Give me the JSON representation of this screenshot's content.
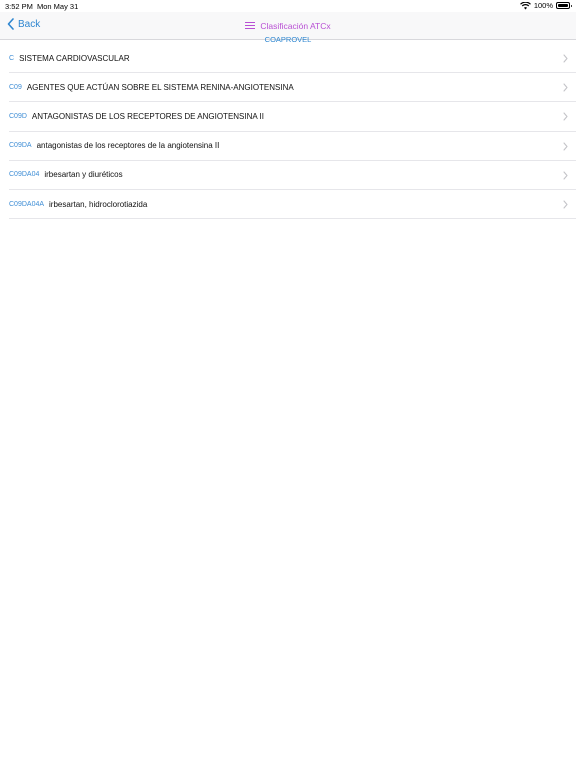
{
  "status": {
    "time": "3:52 PM",
    "date": "Mon May 31",
    "battery": "100%",
    "battery_level": 1.0
  },
  "nav": {
    "back_label": "Back",
    "title": "Clasificación ATCx",
    "subtitle": "COAPROVEL"
  },
  "colors": {
    "accent_blue": "#2e86d0",
    "title_purple": "#b84fd4",
    "code_blue": "#3e8dd5"
  },
  "items": [
    {
      "code": "C",
      "label": "SISTEMA CARDIOVASCULAR"
    },
    {
      "code": "C09",
      "label": "AGENTES QUE ACTÚAN SOBRE EL SISTEMA RENINA-ANGIOTENSINA"
    },
    {
      "code": "C09D",
      "label": "ANTAGONISTAS DE LOS RECEPTORES DE ANGIOTENSINA II"
    },
    {
      "code": "C09DA",
      "label": "antagonistas de los receptores de la angiotensina II"
    },
    {
      "code": "C09DA04",
      "label": "irbesartan y diuréticos"
    },
    {
      "code": "C09DA04A",
      "label": "irbesartan, hidroclorotiazida"
    }
  ]
}
